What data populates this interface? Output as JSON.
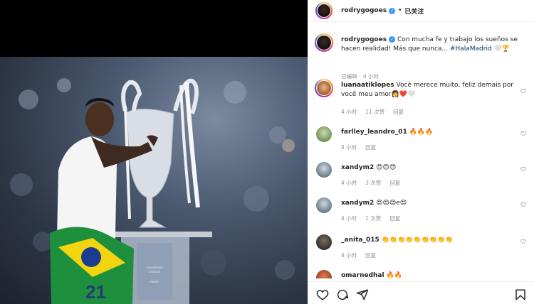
{
  "post": {
    "username": "rodrygogoes",
    "follow_state": "已关注",
    "dot": "•"
  },
  "caption": {
    "username": "rodrygogoes",
    "text": " Con mucha fe y trabajo los sueños se hacen realidad! Más que nunca... ",
    "hashtag": "#HalaMadrid",
    "tail": " 🤍🏆",
    "meta_edited": "已编辑",
    "meta_dot": "·",
    "meta_time": "4 小时"
  },
  "comments": [
    {
      "username": "luanaatiklopes",
      "text": " Você merece muito, feliz demais por você meu amor👩‍❤️🤍",
      "time": "4 小时",
      "likes": "11 次赞",
      "reply": "回复"
    },
    {
      "username": "farlley_leandro_01",
      "text": " 🔥🔥🔥",
      "time": "4 小时",
      "likes": "",
      "reply": "回复"
    },
    {
      "username": "xandym2",
      "text": " 😍😍😍",
      "time": "4 小时",
      "likes": "3 次赞",
      "reply": "回复"
    },
    {
      "username": "xandym2",
      "text": " 😍😍😍e😍",
      "time": "4 小时",
      "likes": "1 次赞",
      "reply": "回复"
    },
    {
      "username": "_anita_015",
      "text": " 👏👏👏👏👏👏👏👏👏",
      "time": "4 小时",
      "likes": "",
      "reply": "回复"
    },
    {
      "username": "omarnedhal",
      "text": " 🔥🔥",
      "time": "",
      "likes": "",
      "reply": ""
    }
  ],
  "photo": {
    "jersey_number": "21",
    "trophy_text_1": "CHAMPIONS",
    "trophy_text_2": "LEAGUE",
    "trophy_text_3": "PARIS"
  },
  "icons": {
    "like": "heart-icon",
    "comment": "comment-icon",
    "share": "share-icon",
    "save": "bookmark-icon"
  },
  "colors": {
    "verified": "#3897f0",
    "hashtag": "#00376b",
    "meta": "#8e8e8e",
    "border": "#efefef"
  }
}
